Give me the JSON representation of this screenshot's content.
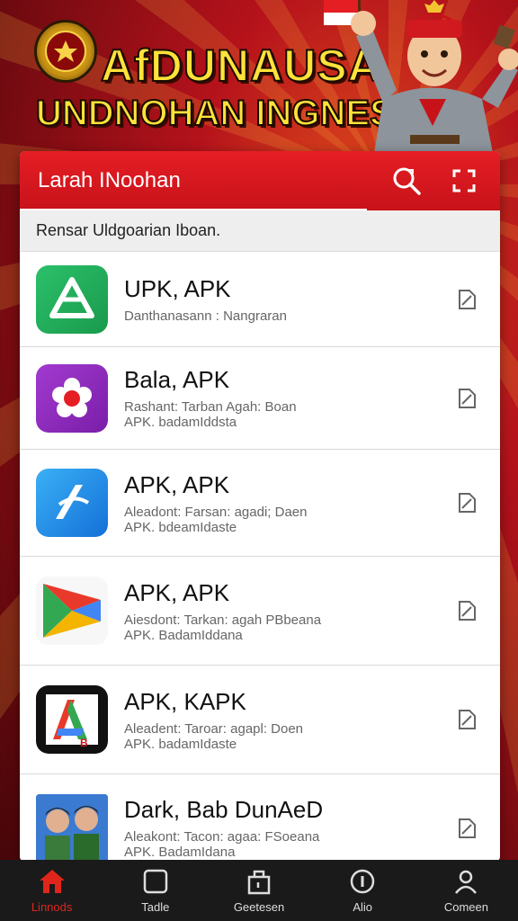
{
  "banner": {
    "title_line1": "AfDUNAUSA",
    "title_line2": "UNDNOHAN INGNESE"
  },
  "header": {
    "title": "Larah INoohan",
    "search_icon": "search-icon",
    "expand_icon": "expand-icon"
  },
  "subheader": "Rensar Uldgoarian Iboan.",
  "items": [
    {
      "title": "UPK, APK",
      "line1": "Danthanasann : Nangraran",
      "line2": "",
      "icon": "google-drive-icon",
      "action_icon": "edit-icon"
    },
    {
      "title": "Bala, APK",
      "line1": "Rashant: Tarban Agah: Boan",
      "line2": "APK. badamIddsta",
      "icon": "flower-app-icon",
      "action_icon": "edit-icon"
    },
    {
      "title": "APK, APK",
      "line1": "Aleadont: Farsan: agadi; Daen",
      "line2": "APK. bdeamIdaste",
      "icon": "app-store-icon",
      "action_icon": "edit-icon"
    },
    {
      "title": "APK, APK",
      "line1": "Aiesdont: Tarkan: agah PBbeana",
      "line2": "APK. BadamIddana",
      "icon": "play-store-icon",
      "action_icon": "edit-icon"
    },
    {
      "title": "APK, KAPK",
      "line1": "Aleadent: Taroar: agapl: Doen",
      "line2": "APK. badamIdaste",
      "icon": "apk-logo-icon",
      "action_icon": "edit-icon"
    },
    {
      "title": "Dark, Bab DunAeD",
      "line1": "Aleakont: Tacon: agaa: FSoeana",
      "line2": "APK. BadamIdana",
      "icon": "game-characters-icon",
      "action_icon": "edit-icon"
    }
  ],
  "nav": [
    {
      "label": "Linnods",
      "icon": "home-icon",
      "active": true
    },
    {
      "label": "Tadle",
      "icon": "square-icon",
      "active": false
    },
    {
      "label": "Geetesen",
      "icon": "bag-icon",
      "active": false
    },
    {
      "label": "Alio",
      "icon": "info-circle-icon",
      "active": false
    },
    {
      "label": "Comeen",
      "icon": "user-icon",
      "active": false
    }
  ],
  "colors": {
    "accent": "#e51e24",
    "nav_bg": "#1a1a1a",
    "banner_text": "#ffe23a"
  }
}
